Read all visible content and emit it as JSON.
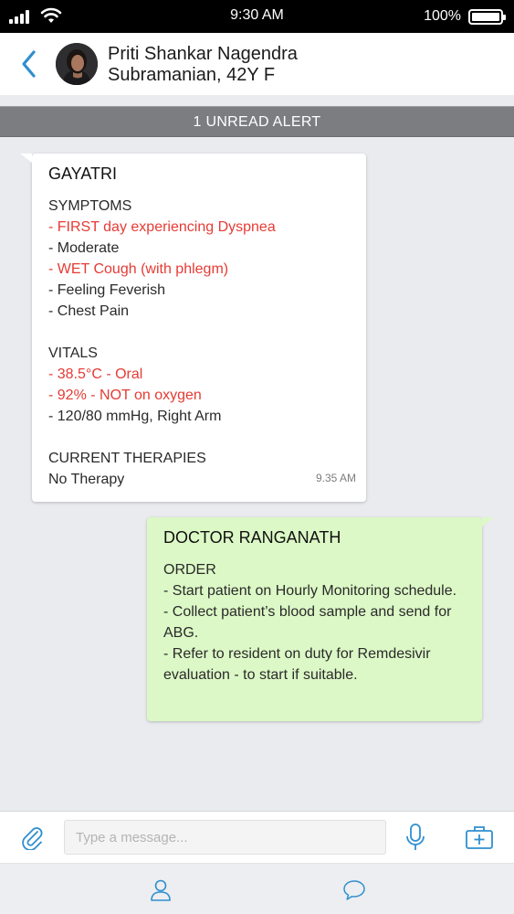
{
  "status_bar": {
    "time": "9:30 AM",
    "battery_percent": "100%",
    "battery_level": 1.0,
    "icons": [
      "signal-icon",
      "wifi-icon",
      "battery-icon"
    ]
  },
  "header": {
    "patient_name": "Priti Shankar Nagendra Subramanian, 42Y F",
    "icons": [
      "back-chevron-icon",
      "avatar"
    ]
  },
  "alert_bar": {
    "text": "1 UNREAD ALERT"
  },
  "messages": [
    {
      "sender": "GAYATRI",
      "direction": "incoming",
      "symptoms_title": "SYMPTOMS",
      "symptoms": [
        {
          "text": "- FIRST day experiencing Dyspnea",
          "highlight": true
        },
        {
          "text": "- Moderate",
          "highlight": false
        },
        {
          "text": "- WET Cough (with phlegm)",
          "highlight": true
        },
        {
          "text": "- Feeling Feverish",
          "highlight": false
        },
        {
          "text": "- Chest Pain",
          "highlight": false
        }
      ],
      "vitals_title": "VITALS",
      "vitals": [
        {
          "text": "- 38.5°C - Oral",
          "highlight": true
        },
        {
          "text": "- 92% - NOT on oxygen",
          "highlight": true
        },
        {
          "text": "- 120/80 mmHg, Right Arm",
          "highlight": false
        }
      ],
      "therapies_title": "CURRENT THERAPIES",
      "therapies": "No Therapy",
      "time": "9.35 AM"
    },
    {
      "sender": "DOCTOR RANGANATH",
      "direction": "outgoing",
      "order_title": "ORDER",
      "order_lines": [
        "- Start patient on Hourly Monitoring schedule.",
        "- Collect patient’s blood sample and send for ABG.",
        "- Refer to resident on duty for Remdesivir evaluation - to start if suitable."
      ]
    }
  ],
  "composer": {
    "placeholder": "Type a message...",
    "value": "",
    "icons": [
      "paperclip-icon",
      "microphone-icon",
      "medical-kit-icon"
    ]
  },
  "tab_bar": {
    "icons": [
      "user-icon",
      "chat-icon"
    ]
  },
  "colors": {
    "alert_red": "#e53b34",
    "accent_blue": "#2f8fcf",
    "alert_bar_gray": "#7b7d80",
    "outgoing_bubble": "#dcf8c6",
    "background": "#e9ebee"
  }
}
